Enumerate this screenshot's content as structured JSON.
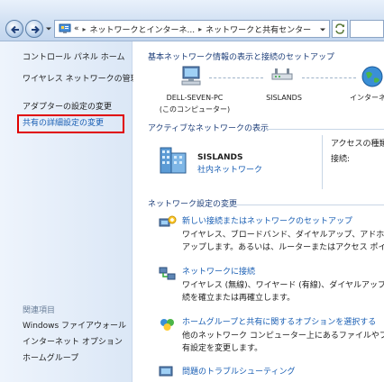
{
  "address": {
    "crumbs": [
      "ネットワークとインターネ...",
      "ネットワークと共有センター"
    ],
    "prefix": "«"
  },
  "left_pane": {
    "items": [
      {
        "label": "コントロール パネル ホーム"
      },
      {
        "label": "ワイヤレス ネットワークの管理"
      },
      {
        "label": "アダプターの設定の変更"
      },
      {
        "label": "共有の詳細設定の変更"
      }
    ],
    "see_also_title": "関連項目",
    "see_also": [
      {
        "label": "Windows ファイアウォール"
      },
      {
        "label": "インターネット オプション"
      },
      {
        "label": "ホームグループ"
      }
    ]
  },
  "main": {
    "map_title": "基本ネットワーク情報の表示と接続のセットアップ",
    "nodes": [
      {
        "label": "DELL-SEVEN-PC",
        "sub": "(このコンピューター)"
      },
      {
        "label": "SISLANDS"
      },
      {
        "label": "インターネ"
      }
    ],
    "active_title": "アクティブなネットワークの表示",
    "network_name": "SISLANDS",
    "network_type": "社内ネットワーク",
    "access_type_label": "アクセスの種類",
    "connection_label": "接続:",
    "settings_title": "ネットワーク設定の変更",
    "tasks": [
      {
        "title": "新しい接続またはネットワークのセットアップ",
        "desc1": "ワイヤレス、ブロードバンド、ダイヤルアップ、アドホック",
        "desc2": "アップします。あるいは、ルーターまたはアクセス ポイン"
      },
      {
        "title": "ネットワークに接続",
        "desc1": "ワイヤレス (無線)、ワイヤード (有線)、ダイヤルアップ、",
        "desc2": "続を確立または再確立します。"
      },
      {
        "title": "ホームグループと共有に関するオプションを選択する",
        "desc1": "他のネットワーク コンピューター上にあるファイルやプリ",
        "desc2": "有設定を変更します。"
      },
      {
        "title": "問題のトラブルシューティング"
      }
    ]
  }
}
